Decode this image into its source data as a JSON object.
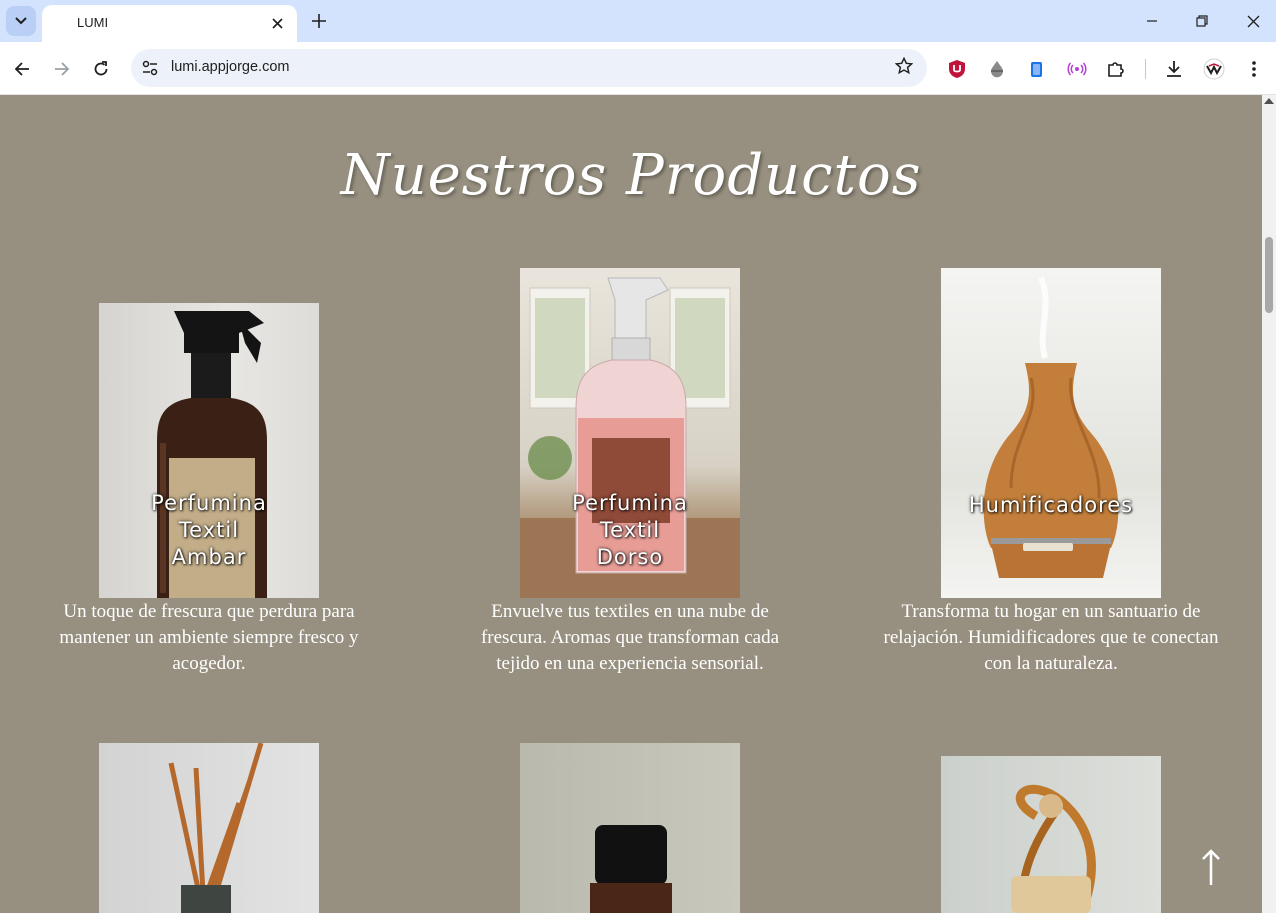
{
  "browser": {
    "tab_title": "LUMI",
    "url": "lumi.appjorge.com"
  },
  "page": {
    "heading": "Nuestros Productos",
    "products": [
      {
        "label": "Perfumina\nTextil\nAmbar",
        "description": "Un toque de frescura que perdura para mantener un ambiente siempre fresco y acogedor."
      },
      {
        "label": "Perfumina\nTextil\nDorso",
        "description": "Envuelve tus textiles en una nube de frescura. Aromas que transforman cada tejido en una experiencia sensorial."
      },
      {
        "label": "Humificadores",
        "description": "Transforma tu hogar en un santuario de relajación. Humidificadores que te conectan con la naturaleza."
      }
    ],
    "back_to_top": "↑"
  },
  "colors": {
    "page_background": "#979080",
    "tabstrip": "#d3e3fd",
    "text": "#ffffff"
  }
}
